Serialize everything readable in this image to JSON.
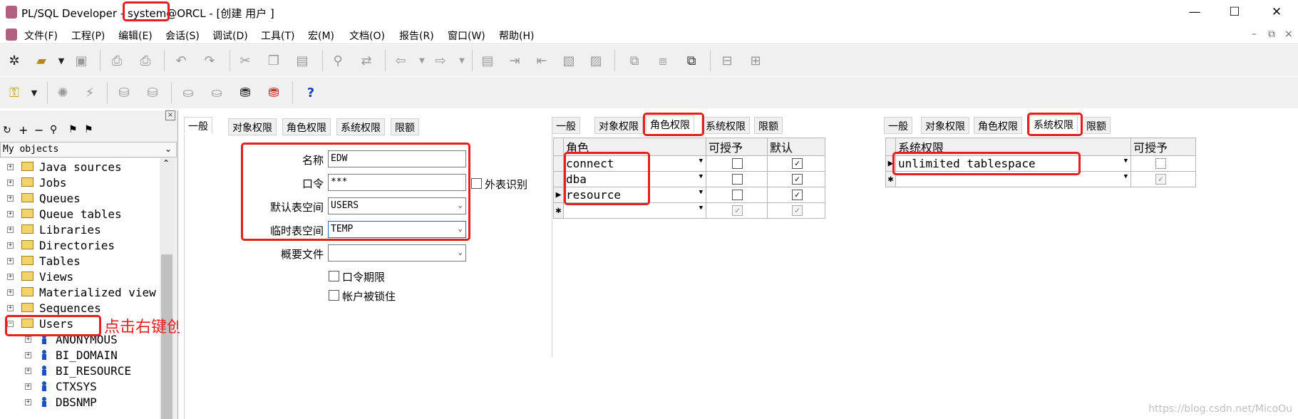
{
  "window": {
    "title": "PL/SQL Developer - system@ORCL - [创建 用户 ]",
    "minimize_icon": "—",
    "maximize_icon": "☐",
    "close_icon": "✕"
  },
  "menubar": {
    "items": [
      "文件(F)",
      "工程(P)",
      "编辑(E)",
      "会话(S)",
      "调试(D)",
      "工具(T)",
      "宏(M)",
      "文档(O)",
      "报告(R)",
      "窗口(W)",
      "帮助(H)"
    ],
    "mdi_buttons": [
      "–",
      "⧉",
      "×"
    ]
  },
  "left_panel": {
    "dropdown_label": "My objects",
    "tree_items": [
      "Java sources",
      "Jobs",
      "Queues",
      "Queue tables",
      "Libraries",
      "Directories",
      "Tables",
      "Views",
      "Materialized view",
      "Sequences",
      "Users"
    ],
    "users": [
      "ANONYMOUS",
      "BI_DOMAIN",
      "BI_RESOURCE",
      "CTXSYS",
      "DBSNMP"
    ]
  },
  "annotation": "点击右键创建",
  "panel1": {
    "tabs": [
      "一般",
      "对象权限",
      "角色权限",
      "系统权限",
      "限额"
    ],
    "fields": {
      "name_label": "名称",
      "name_value": "EDW",
      "password_label": "口令",
      "password_value": "***",
      "external_id_label": "外表识别",
      "default_ts_label": "默认表空间",
      "default_ts_value": "USERS",
      "temp_ts_label": "临时表空间",
      "temp_ts_value": "TEMP",
      "profile_label": "概要文件",
      "profile_value": ""
    },
    "checkboxes": [
      "口令期限",
      "帐户被锁住"
    ]
  },
  "panel2": {
    "tabs": [
      "一般",
      "对象权限",
      "角色权限",
      "系统权限",
      "限额"
    ],
    "headers": [
      "角色",
      "可授予",
      "默认"
    ],
    "rows": [
      {
        "role": "connect",
        "grantable": false,
        "default": true
      },
      {
        "role": "dba",
        "grantable": false,
        "default": true
      },
      {
        "role": "resource",
        "grantable": false,
        "default": true
      }
    ]
  },
  "panel3": {
    "tabs": [
      "一般",
      "对象权限",
      "角色权限",
      "系统权限",
      "限额"
    ],
    "headers": [
      "系统权限",
      "可授予"
    ],
    "rows": [
      {
        "privilege": "unlimited tablespace",
        "grantable": false
      }
    ]
  },
  "watermark": "https://blog.csdn.net/MicoOu"
}
